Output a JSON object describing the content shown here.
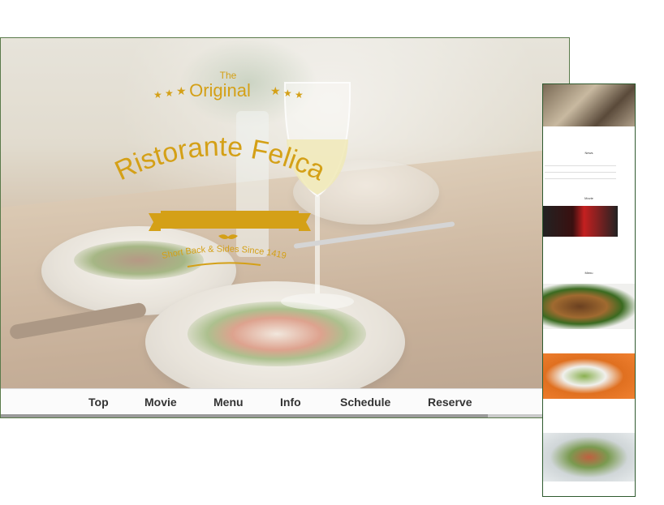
{
  "logo": {
    "the": "The",
    "original": "Original",
    "name": "Ristorante Felica",
    "tagline": "Short Back & Sides Since 1419"
  },
  "nav": {
    "items": [
      "Top",
      "Movie",
      "Menu",
      "Info",
      "Schedule",
      "Reserve"
    ]
  },
  "mobile": {
    "section_news": "News",
    "section_movie": "Movie",
    "section_menu": "Menu"
  },
  "colors": {
    "brand_gold": "#d4a017",
    "border_green": "#2f5a2f"
  }
}
